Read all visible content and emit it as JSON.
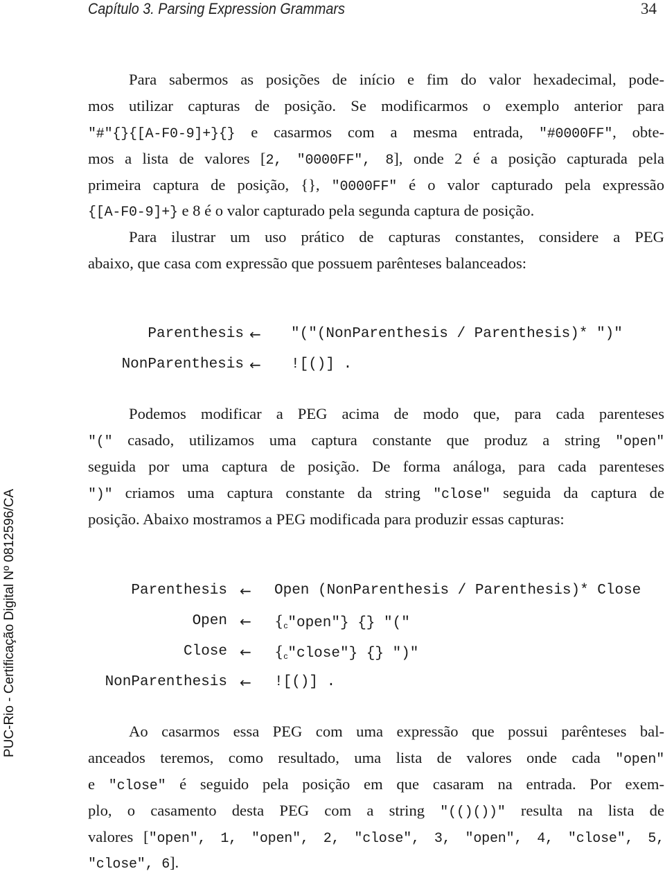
{
  "header": {
    "chapter_title": "Capítulo 3. Parsing Expression Grammars",
    "page_number": "34"
  },
  "sidebar_stamp": "PUC-Rio - Certificação Digital Nº 0812596/CA",
  "paragraph1": {
    "lines": [
      [
        "Para sabermos as posições de início e fim do valor hexadecimal, pode-"
      ],
      [
        "mos utilizar capturas de posição. Se modificarmos o exemplo anterior para"
      ],
      [
        "\"#\"{}{[A-F0-9]+}{}",
        " e casarmos com a mesma entrada, ",
        "\"#0000FF\"",
        ", obte-"
      ],
      [
        "mos a lista de valores [",
        "2, \"0000FF\", 8",
        "], onde 2 é a posição capturada pela"
      ],
      [
        "primeira captura de posição, {}, ",
        "\"0000FF\"",
        " é o valor capturado pela expressão"
      ],
      [
        "{[A-F0-9]+}",
        " e 8 é o valor capturado pela segunda captura de posição."
      ]
    ]
  },
  "paragraph2": {
    "lines": [
      [
        "Para ilustrar um uso prático de capturas constantes, considere a PEG"
      ],
      [
        "abaixo, que casa com expressão que possuem parênteses balanceados:"
      ]
    ]
  },
  "grammar1": {
    "arrow": "←",
    "rules": [
      {
        "lhs": "Parenthesis",
        "rhs": "\"(\"(NonParenthesis / Parenthesis)* \")\""
      },
      {
        "lhs": "NonParenthesis",
        "rhs": "![()] ."
      }
    ]
  },
  "paragraph3": {
    "lines": [
      [
        "Podemos modificar a PEG acima de modo que, para cada parenteses"
      ],
      [
        "\"(\"",
        " casado, utilizamos uma captura constante que produz a string ",
        "\"open\""
      ],
      [
        "seguida por uma captura de posição. De forma análoga, para cada parenteses"
      ],
      [
        "\")\"",
        " criamos uma captura constante da string ",
        "\"close\"",
        " seguida da captura de"
      ],
      [
        "posição. Abaixo mostramos a PEG modificada para produzir essas capturas:"
      ]
    ]
  },
  "grammar2": {
    "arrow": "←",
    "const_subscript": "c",
    "rules": [
      {
        "lhs": "Parenthesis",
        "rhs": "Open (NonParenthesis / Parenthesis)* Close"
      },
      {
        "lhs": "Open",
        "rhs_pre": "{",
        "rhs_const": "\"open\"",
        "rhs_post": "} {} \"(\""
      },
      {
        "lhs": "Close",
        "rhs_pre": "{",
        "rhs_const": "\"close\"",
        "rhs_post": "} {} \")\""
      },
      {
        "lhs": "NonParenthesis",
        "rhs": "![()] ."
      }
    ]
  },
  "paragraph4": {
    "lines": [
      [
        "Ao casarmos essa PEG com uma expressão que possui parênteses bal-"
      ],
      [
        "anceados teremos, como resultado, uma lista de valores onde cada ",
        "\"open\""
      ],
      [
        "e ",
        "\"close\"",
        " é seguido pela posição em que casaram na entrada. Por exem-"
      ],
      [
        "plo, o casamento desta PEG com a string ",
        "\"(()())\"",
        " resulta na lista de"
      ],
      [
        "valores ",
        "[",
        "\"open\", 1, \"open\", 2, \"close\", 3, \"open\", 4, \"close\", 5,"
      ],
      [
        "\"close\", 6",
        "]."
      ]
    ]
  }
}
